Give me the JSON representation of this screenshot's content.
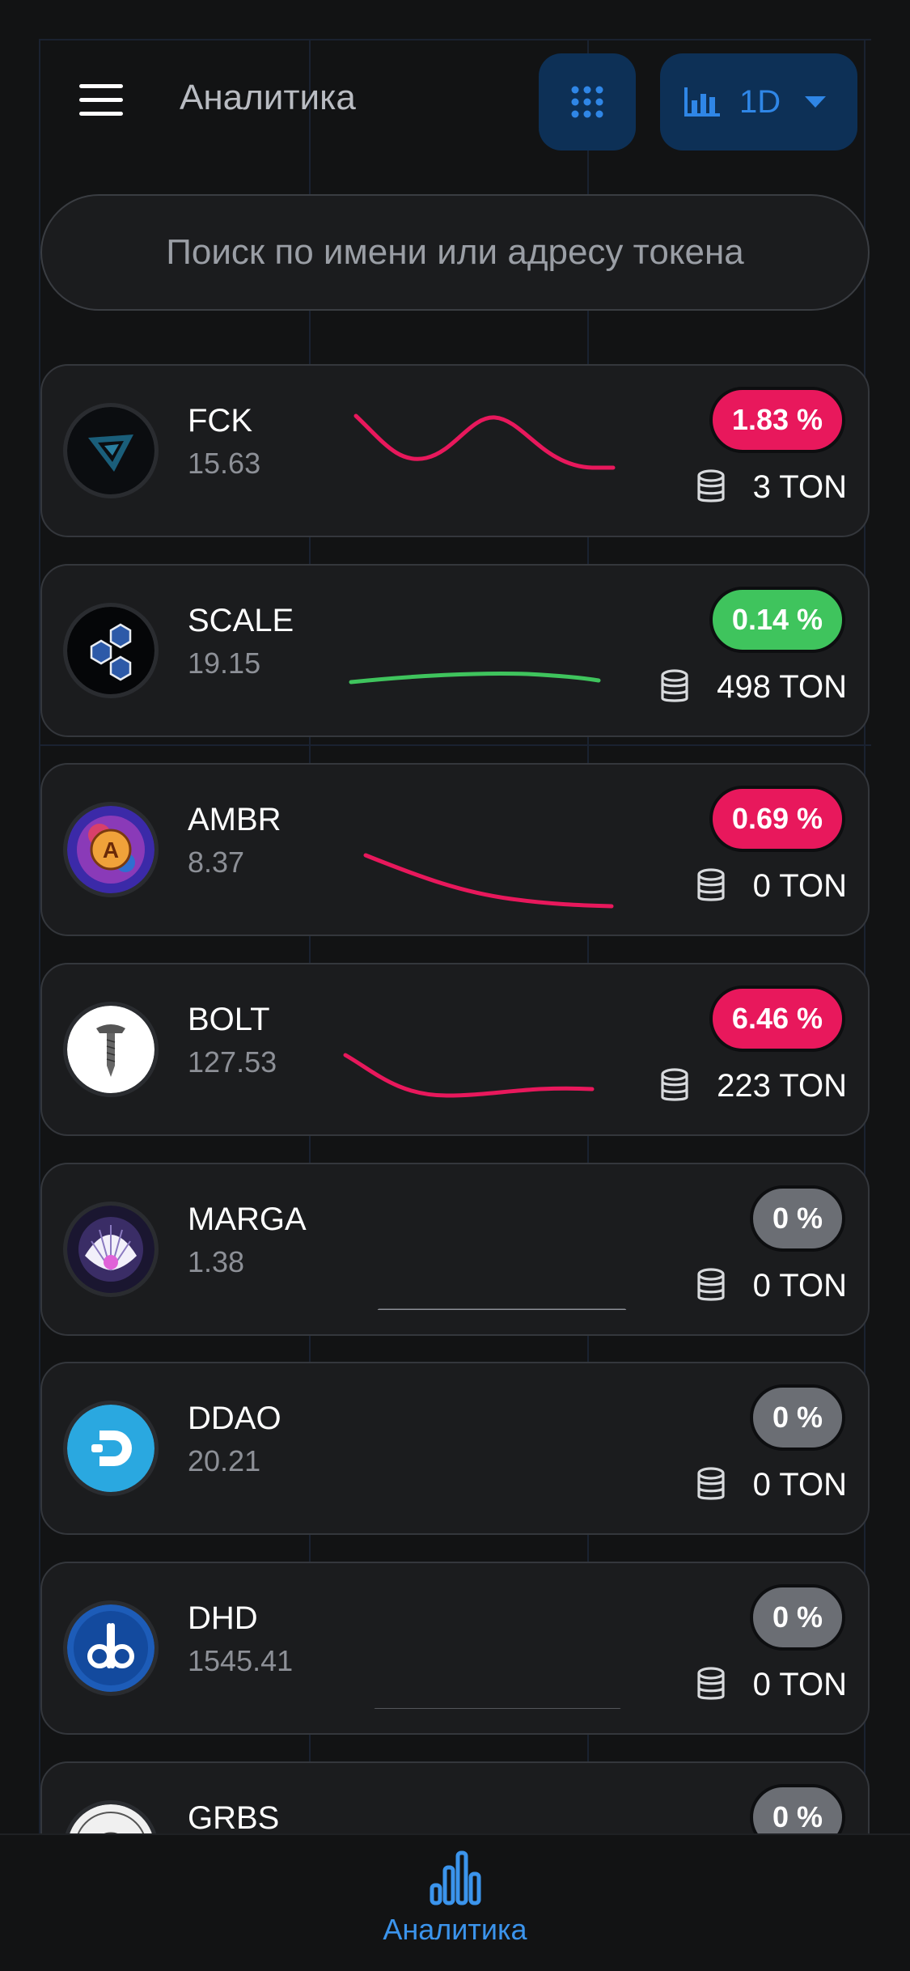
{
  "header": {
    "title": "Аналитика",
    "period": "1D",
    "menu_icon": "hamburger-menu-icon",
    "grid_icon": "dots-grid-icon",
    "chart_icon": "bar-chart-icon",
    "caret_icon": "caret-down-icon"
  },
  "search": {
    "placeholder": "Поиск по имени или адресу токена"
  },
  "colors": {
    "background": "#121314",
    "card": "#1b1c1e",
    "accent": "#2f86e6",
    "negative": "#e8185c",
    "positive": "#3fc45d",
    "neutral": "#6b6e74"
  },
  "tokens": [
    {
      "name": "FCK",
      "price": "15.63",
      "change": "1.83 %",
      "trend": "down",
      "volume": "3 TON"
    },
    {
      "name": "SCALE",
      "price": "19.15",
      "change": "0.14 %",
      "trend": "up",
      "volume": "498 TON"
    },
    {
      "name": "AMBR",
      "price": "8.37",
      "change": "0.69 %",
      "trend": "down",
      "volume": "0 TON"
    },
    {
      "name": "BOLT",
      "price": "127.53",
      "change": "6.46 %",
      "trend": "down",
      "volume": "223 TON"
    },
    {
      "name": "MARGA",
      "price": "1.38",
      "change": "0 %",
      "trend": "flat",
      "volume": "0 TON"
    },
    {
      "name": "DDAO",
      "price": "20.21",
      "change": "0 %",
      "trend": "flat",
      "volume": "0 TON"
    },
    {
      "name": "DHD",
      "price": "1545.41",
      "change": "0 %",
      "trend": "flat",
      "volume": "0 TON"
    },
    {
      "name": "GRBS",
      "price": "",
      "change": "0 %",
      "trend": "flat",
      "volume": ""
    }
  ],
  "bottom_nav": {
    "analytics_label": "Аналитика",
    "analytics_icon": "analytics-bars-icon"
  }
}
